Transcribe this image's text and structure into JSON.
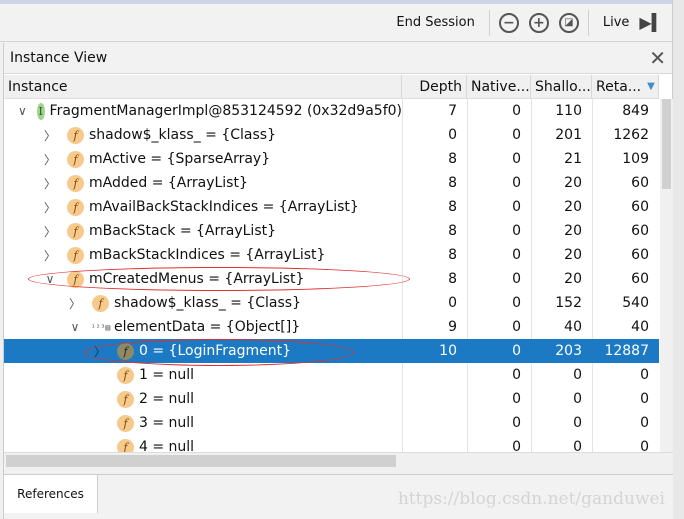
{
  "toolbar": {
    "end_session": "End Session",
    "live": "Live"
  },
  "panel": {
    "title": "Instance View"
  },
  "columns": [
    "Instance",
    "Depth",
    "Native...",
    "Shallo...",
    "Reta..."
  ],
  "rows": [
    {
      "level": 0,
      "expand": "down",
      "icon": "I",
      "label": "FragmentManagerImpl@853124592 (0x32d9a5f0)",
      "depth": "7",
      "native": "0",
      "shallow": "110",
      "retained": "849"
    },
    {
      "level": 1,
      "expand": "right",
      "icon": "f",
      "label": "shadow$_klass_ = {Class}",
      "depth": "0",
      "native": "0",
      "shallow": "201",
      "retained": "1262"
    },
    {
      "level": 1,
      "expand": "right",
      "icon": "f",
      "label": "mActive = {SparseArray}",
      "depth": "8",
      "native": "0",
      "shallow": "21",
      "retained": "109"
    },
    {
      "level": 1,
      "expand": "right",
      "icon": "f",
      "label": "mAdded = {ArrayList}",
      "depth": "8",
      "native": "0",
      "shallow": "20",
      "retained": "60"
    },
    {
      "level": 1,
      "expand": "right",
      "icon": "f",
      "label": "mAvailBackStackIndices = {ArrayList}",
      "depth": "8",
      "native": "0",
      "shallow": "20",
      "retained": "60"
    },
    {
      "level": 1,
      "expand": "right",
      "icon": "f",
      "label": "mBackStack = {ArrayList}",
      "depth": "8",
      "native": "0",
      "shallow": "20",
      "retained": "60"
    },
    {
      "level": 1,
      "expand": "right",
      "icon": "f",
      "label": "mBackStackIndices = {ArrayList}",
      "depth": "8",
      "native": "0",
      "shallow": "20",
      "retained": "60"
    },
    {
      "level": 1,
      "expand": "down",
      "icon": "f",
      "label": "mCreatedMenus = {ArrayList}",
      "depth": "8",
      "native": "0",
      "shallow": "20",
      "retained": "60"
    },
    {
      "level": 2,
      "expand": "right",
      "icon": "f",
      "label": "shadow$_klass_ = {Class}",
      "depth": "0",
      "native": "0",
      "shallow": "152",
      "retained": "540"
    },
    {
      "level": 2,
      "expand": "down",
      "icon": "array",
      "label": "elementData = {Object[]}",
      "depth": "9",
      "native": "0",
      "shallow": "40",
      "retained": "40"
    },
    {
      "level": 3,
      "expand": "right",
      "icon": "f",
      "label": "0 = {LoginFragment}",
      "depth": "10",
      "native": "0",
      "shallow": "203",
      "retained": "12887",
      "selected": true
    },
    {
      "level": 3,
      "expand": "none",
      "icon": "f",
      "label": "1 = null",
      "depth": "",
      "native": "0",
      "shallow": "0",
      "retained": "0"
    },
    {
      "level": 3,
      "expand": "none",
      "icon": "f",
      "label": "2 = null",
      "depth": "",
      "native": "0",
      "shallow": "0",
      "retained": "0"
    },
    {
      "level": 3,
      "expand": "none",
      "icon": "f",
      "label": "3 = null",
      "depth": "",
      "native": "0",
      "shallow": "0",
      "retained": "0"
    },
    {
      "level": 3,
      "expand": "none",
      "icon": "f",
      "label": "4 = null",
      "depth": "",
      "native": "0",
      "shallow": "0",
      "retained": "0"
    }
  ],
  "bottom": {
    "references_tab": "References",
    "watermark": "https://blog.csdn.net/ganduwei"
  },
  "colors": {
    "selection": "#1b7ac3",
    "annotation": "#e03030"
  }
}
